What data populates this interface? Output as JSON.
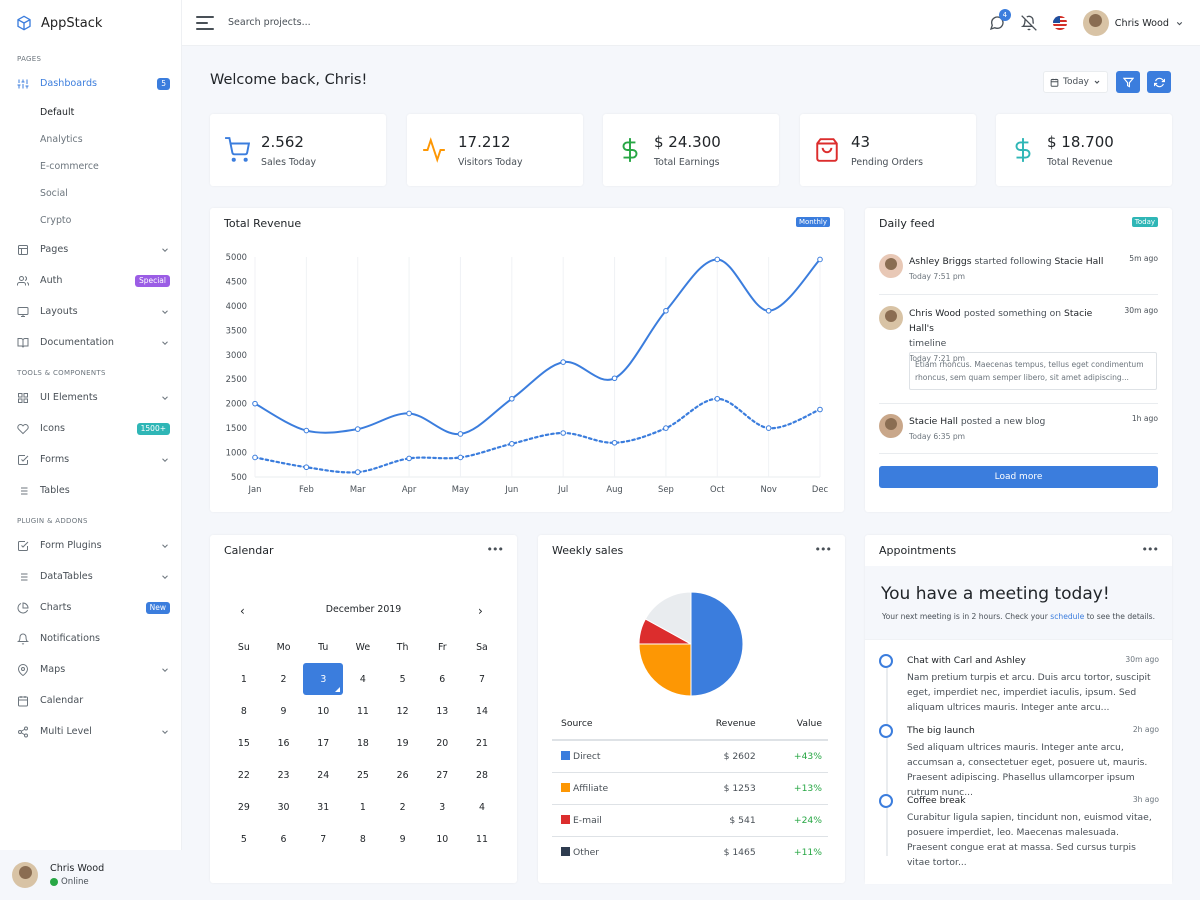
{
  "brand": {
    "name": "AppStack"
  },
  "sidebar": {
    "sections": [
      "Pages",
      "Tools & Components",
      "Plugin & Addons"
    ],
    "dashboards": {
      "label": "Dashboards",
      "badge": "5",
      "sub": [
        "Default",
        "Analytics",
        "E-commerce",
        "Social",
        "Crypto"
      ]
    },
    "pages": "Pages",
    "auth": {
      "label": "Auth",
      "badge": "Special"
    },
    "layouts": "Layouts",
    "documentation": "Documentation",
    "ui_elements": "UI Elements",
    "icons": {
      "label": "Icons",
      "badge": "1500+"
    },
    "forms": "Forms",
    "tables": "Tables",
    "form_plugins": "Form Plugins",
    "datatables": "DataTables",
    "charts": {
      "label": "Charts",
      "badge": "New"
    },
    "notifications": "Notifications",
    "maps": "Maps",
    "calendar": "Calendar",
    "multi_level": "Multi Level",
    "user": {
      "name": "Chris Wood",
      "status": "Online"
    }
  },
  "topbar": {
    "search_placeholder": "Search projects...",
    "messages_count": "4",
    "user_name": "Chris Wood"
  },
  "welcome": "Welcome back, Chris!",
  "date_filter": "Today",
  "stats": [
    {
      "value": "2.562",
      "label": "Sales Today"
    },
    {
      "value": "17.212",
      "label": "Visitors Today"
    },
    {
      "value": "$ 24.300",
      "label": "Total Earnings"
    },
    {
      "value": "43",
      "label": "Pending Orders"
    },
    {
      "value": "$ 18.700",
      "label": "Total Revenue"
    }
  ],
  "revenue_card": {
    "title": "Total Revenue",
    "badge": "Monthly"
  },
  "chart_data": {
    "type": "line",
    "categories": [
      "Jan",
      "Feb",
      "Mar",
      "Apr",
      "May",
      "Jun",
      "Jul",
      "Aug",
      "Sep",
      "Oct",
      "Nov",
      "Dec"
    ],
    "series": [
      {
        "values": [
          2000,
          1450,
          1480,
          1800,
          1380,
          2100,
          2850,
          2520,
          3900,
          4950,
          3900,
          4950
        ],
        "style": "solid"
      },
      {
        "values": [
          900,
          700,
          600,
          880,
          900,
          1180,
          1400,
          1200,
          1500,
          2100,
          1500,
          1880
        ],
        "style": "dotted"
      }
    ],
    "yticks": [
      500,
      1000,
      1500,
      2000,
      2500,
      3000,
      3500,
      4000,
      4500,
      5000
    ],
    "ylim": [
      500,
      5000
    ],
    "color": "#3b7ddd"
  },
  "feed": {
    "title": "Daily feed",
    "badge": "Today",
    "items": [
      {
        "user": "Ashley Briggs",
        "action": "started following",
        "target": "Stacie Hall",
        "time": "Today 7:51 pm",
        "ago": "5m ago"
      },
      {
        "user": "Chris Wood",
        "action": "posted something on",
        "target": "Stacie Hall's",
        "tail": "timeline",
        "time": "Today 7:21 pm",
        "ago": "30m ago",
        "quote": "Etiam rhoncus. Maecenas tempus, tellus eget condimentum rhoncus, sem quam semper libero, sit amet adipiscing..."
      },
      {
        "user": "Stacie Hall",
        "action": "posted a new blog",
        "time": "Today 6:35 pm",
        "ago": "1h ago"
      }
    ],
    "load_more": "Load more"
  },
  "calendar": {
    "title": "Calendar",
    "month": "December 2019",
    "weekdays": [
      "Su",
      "Mo",
      "Tu",
      "We",
      "Th",
      "Fr",
      "Sa"
    ],
    "days": [
      "1",
      "2",
      "3",
      "4",
      "5",
      "6",
      "7",
      "8",
      "9",
      "10",
      "11",
      "12",
      "13",
      "14",
      "15",
      "16",
      "17",
      "18",
      "19",
      "20",
      "21",
      "22",
      "23",
      "24",
      "25",
      "26",
      "27",
      "28",
      "29",
      "30",
      "31",
      "1",
      "2",
      "3",
      "4",
      "5",
      "6",
      "7",
      "8",
      "9",
      "10",
      "11"
    ],
    "selected": "3"
  },
  "weekly": {
    "title": "Weekly sales",
    "headers": [
      "Source",
      "Revenue",
      "Value"
    ],
    "rows": [
      {
        "source": "Direct",
        "revenue": "$ 2602",
        "value": "+43%",
        "color": "#3b7ddd"
      },
      {
        "source": "Affiliate",
        "revenue": "$ 1253",
        "value": "+13%",
        "color": "#fd9704"
      },
      {
        "source": "E-mail",
        "revenue": "$ 541",
        "value": "+24%",
        "color": "#dc2d2d"
      },
      {
        "source": "Other",
        "revenue": "$ 1465",
        "value": "+11%",
        "color": "#2e3c4f"
      }
    ],
    "pie": [
      {
        "value": 50,
        "color": "#3b7ddd"
      },
      {
        "value": 25,
        "color": "#fd9704"
      },
      {
        "value": 8,
        "color": "#dc2d2d"
      },
      {
        "value": 17,
        "color": "#e9ecef"
      }
    ]
  },
  "appointments": {
    "title": "Appointments",
    "headline": "You have a meeting today!",
    "sub_pre": "Your next meeting is in 2 hours. Check your",
    "sub_link": "schedule",
    "sub_post": "to see the details.",
    "items": [
      {
        "title": "Chat with Carl and Ashley",
        "time": "30m ago",
        "body": "Nam pretium turpis et arcu. Duis arcu tortor, suscipit eget, imperdiet nec, imperdiet iaculis, ipsum. Sed aliquam ultrices mauris. Integer ante arcu..."
      },
      {
        "title": "The big launch",
        "time": "2h ago",
        "body": "Sed aliquam ultrices mauris. Integer ante arcu, accumsan a, consectetuer eget, posuere ut, mauris. Praesent adipiscing. Phasellus ullamcorper ipsum rutrum nunc..."
      },
      {
        "title": "Coffee break",
        "time": "3h ago",
        "body": "Curabitur ligula sapien, tincidunt non, euismod vitae, posuere imperdiet, leo. Maecenas malesuada. Praesent congue erat at massa. Sed cursus turpis vitae tortor..."
      }
    ]
  }
}
